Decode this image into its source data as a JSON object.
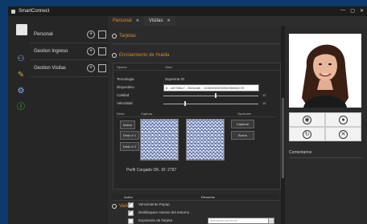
{
  "window": {
    "title": "SmartConnect",
    "controls": [
      "—",
      "▢",
      "✕"
    ]
  },
  "sidebar": {
    "menu": [
      {
        "label": "Personal"
      },
      {
        "label": "Gestion Ingreso"
      },
      {
        "label": "Gestion Visitas"
      }
    ],
    "tools": [
      "users-icon",
      "wand-icon",
      "settings-icon",
      "info-icon"
    ]
  },
  "tabs": [
    {
      "label": "Personal",
      "active": true
    },
    {
      "label": "Visitas",
      "active": false
    }
  ],
  "main": {
    "section1": "Tarjetas",
    "section2": "Enrolamiento de Huella",
    "panel": {
      "col_param": "Opcion",
      "col_value": "Valor",
      "rows": [
        {
          "label": "Tecnologia",
          "value": "Suprema IO"
        },
        {
          "label": "Dispositivo",
          "value": "8 - 187330u7 - 3D0c6d0 - 1D30000300003030006C7E"
        },
        {
          "label": "Calidad",
          "value": "10"
        },
        {
          "label": "Velocidad",
          "value": "15"
        }
      ],
      "captura_h": {
        "dedo": "Dedo",
        "captura": "Captura",
        "opciones": "Opciones"
      },
      "left_buttons": [
        "Nuevo",
        "Dedo # 1",
        "Dedo # 2"
      ],
      "right_buttons": [
        "Capturar",
        "Borrar"
      ],
      "perfil": "Perfil Cargado OK. ID: 2787"
    },
    "section3": "Varios",
    "table": {
      "col_activo": "Activo",
      "col_elemento": "Elemento",
      "rows": [
        {
          "label": "Vencimiento Popup",
          "checked": true
        },
        {
          "label": "Desbloqueo masivo del entorno",
          "checked": true
        },
        {
          "label": "Expiración de Tarjeta",
          "checked": false,
          "input_placeholder": "Seleccione una fecha",
          "btn": "..."
        }
      ]
    }
  },
  "right": {
    "comentarios": "Comentarios",
    "actions": [
      "camera-icon",
      "record-icon",
      "refresh-icon",
      "close-icon"
    ]
  }
}
